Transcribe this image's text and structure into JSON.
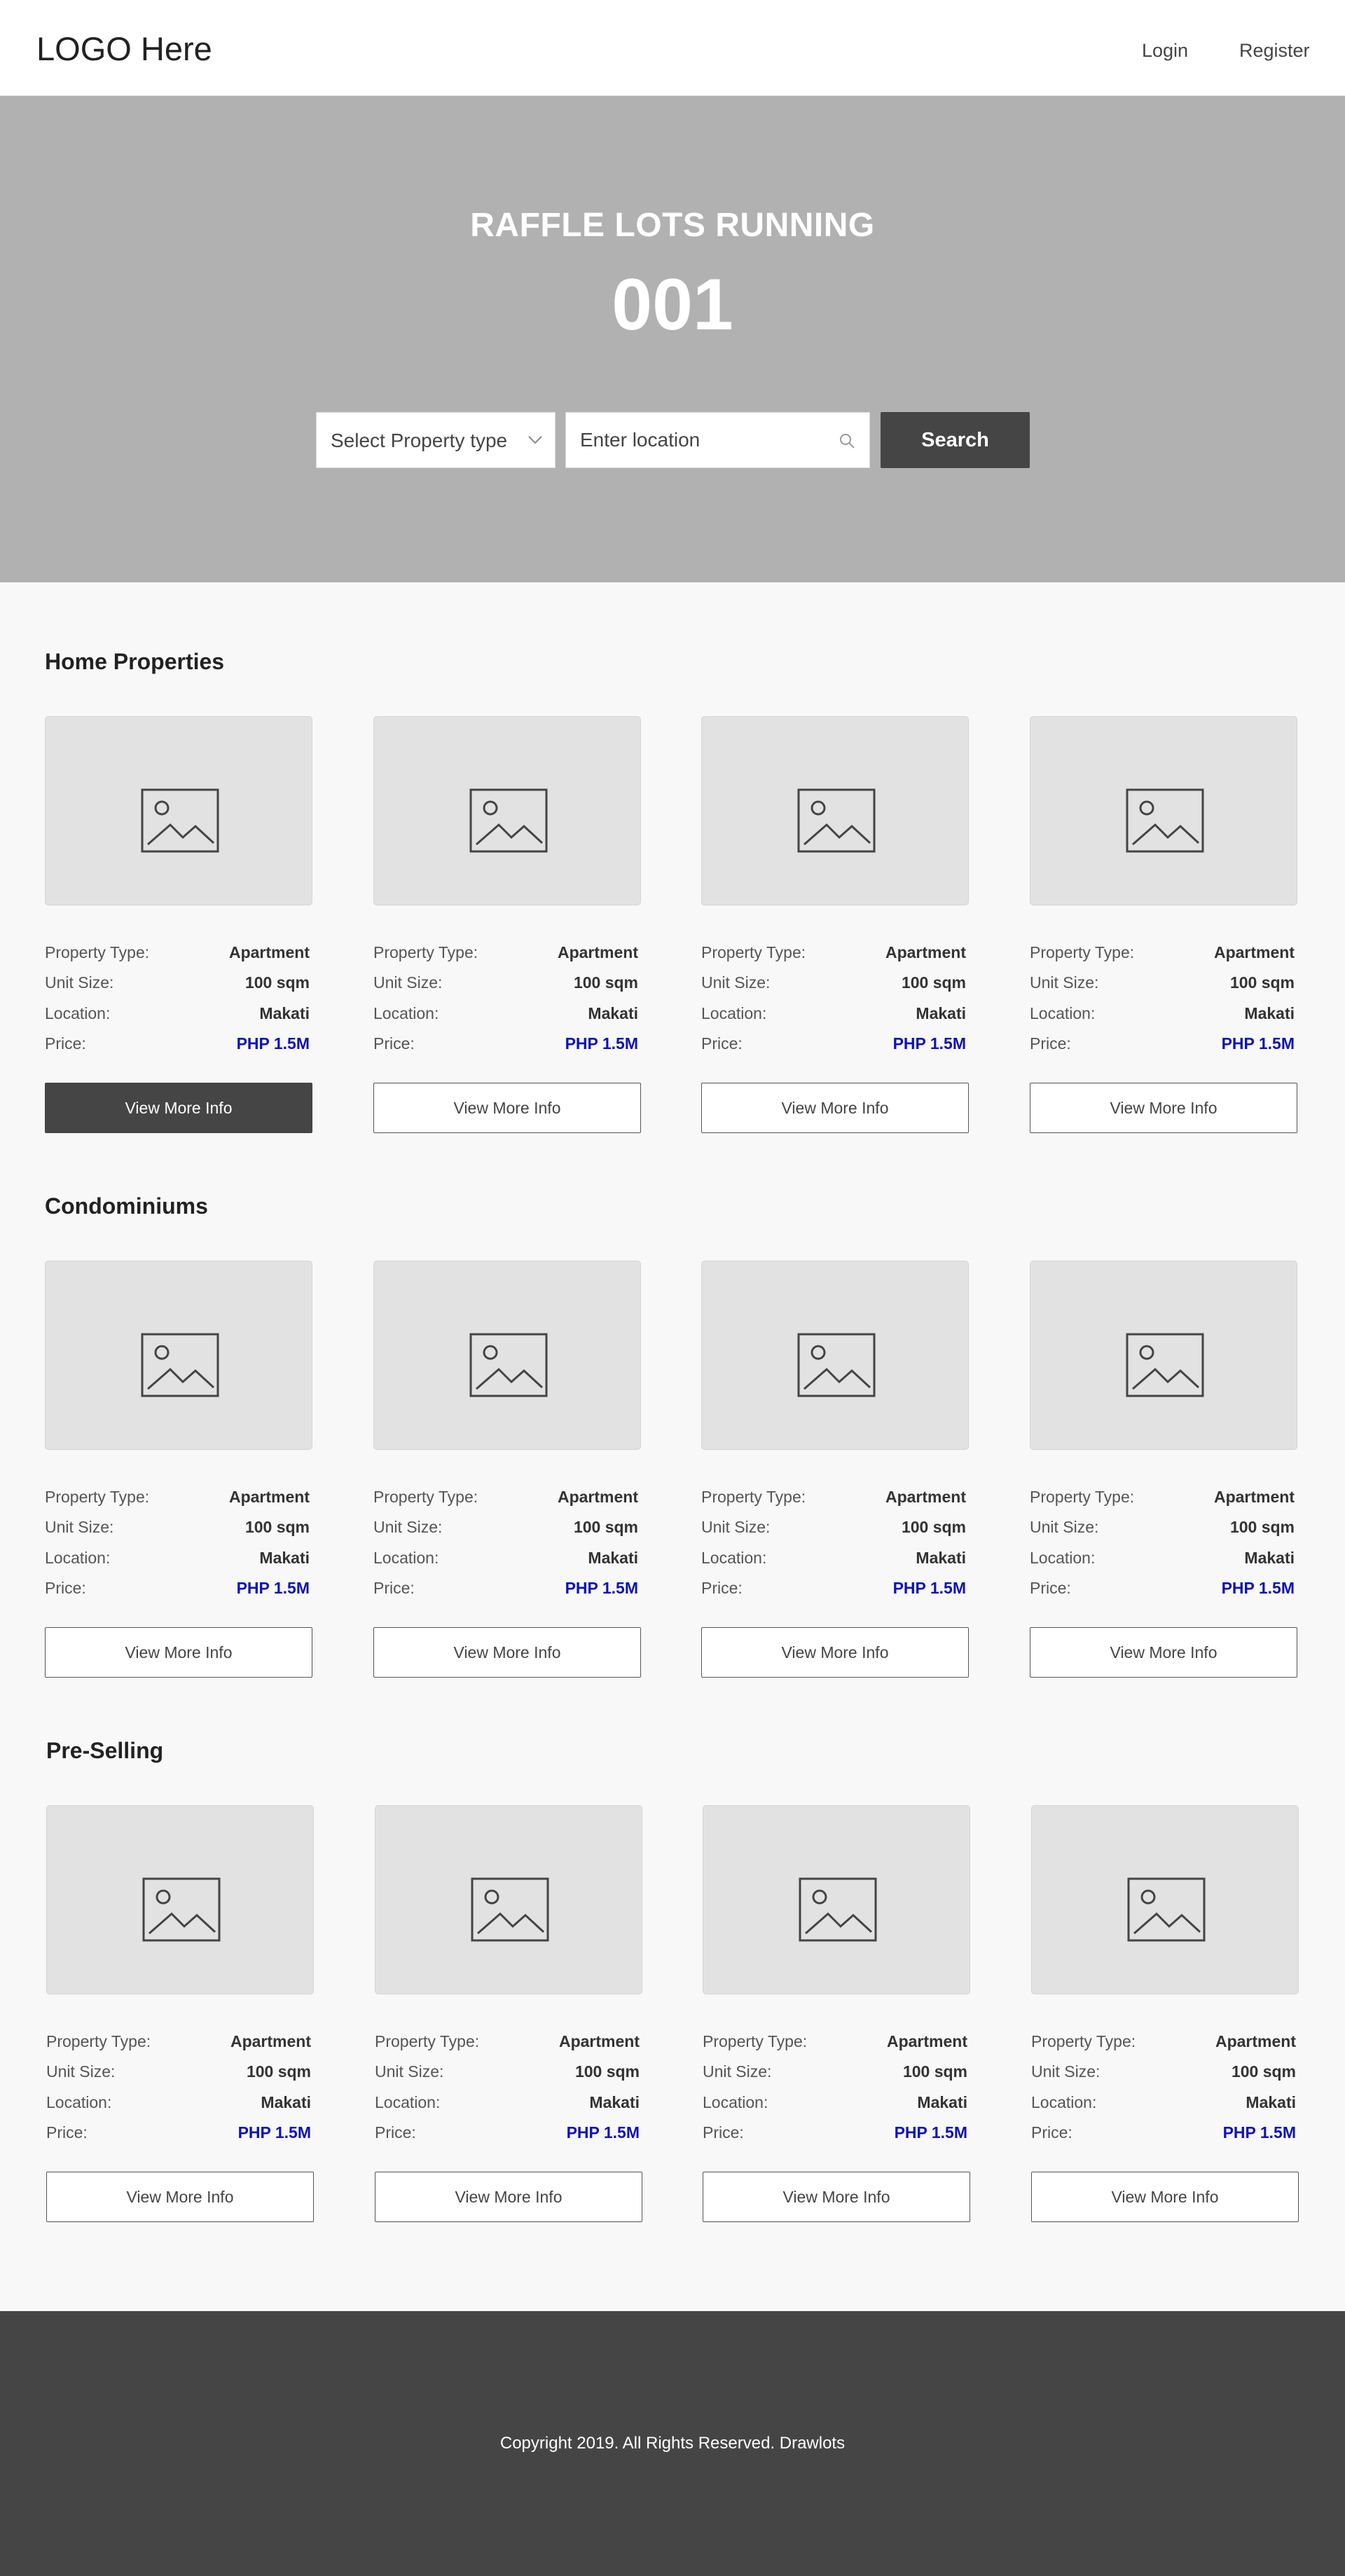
{
  "header": {
    "logo": "LOGO Here",
    "login": "Login",
    "register": "Register"
  },
  "hero": {
    "title": "RAFFLE LOTS RUNNING",
    "count": "001",
    "property_type_select": "Select Property type",
    "location_placeholder": "Enter location",
    "search_button": "Search"
  },
  "card_labels": {
    "property_type": "Property Type:",
    "unit_size": "Unit Size:",
    "location": "Location:",
    "price": "Price:",
    "button": "View More Info"
  },
  "sections": [
    {
      "title": "Home Properties",
      "cards": [
        {
          "property_type": "Apartment",
          "unit_size": "100 sqm",
          "location": "Makati",
          "price": "PHP 1.5M"
        },
        {
          "property_type": "Apartment",
          "unit_size": "100 sqm",
          "location": "Makati",
          "price": "PHP 1.5M"
        },
        {
          "property_type": "Apartment",
          "unit_size": "100 sqm",
          "location": "Makati",
          "price": "PHP 1.5M"
        },
        {
          "property_type": "Apartment",
          "unit_size": "100 sqm",
          "location": "Makati",
          "price": "PHP 1.5M"
        }
      ]
    },
    {
      "title": "Condominiums",
      "cards": [
        {
          "property_type": "Apartment",
          "unit_size": "100 sqm",
          "location": "Makati",
          "price": "PHP 1.5M"
        },
        {
          "property_type": "Apartment",
          "unit_size": "100 sqm",
          "location": "Makati",
          "price": "PHP 1.5M"
        },
        {
          "property_type": "Apartment",
          "unit_size": "100 sqm",
          "location": "Makati",
          "price": "PHP 1.5M"
        },
        {
          "property_type": "Apartment",
          "unit_size": "100 sqm",
          "location": "Makati",
          "price": "PHP 1.5M"
        }
      ]
    },
    {
      "title": "Pre-Selling",
      "cards": [
        {
          "property_type": "Apartment",
          "unit_size": "100 sqm",
          "location": "Makati",
          "price": "PHP 1.5M"
        },
        {
          "property_type": "Apartment",
          "unit_size": "100 sqm",
          "location": "Makati",
          "price": "PHP 1.5M"
        },
        {
          "property_type": "Apartment",
          "unit_size": "100 sqm",
          "location": "Makati",
          "price": "PHP 1.5M"
        },
        {
          "property_type": "Apartment",
          "unit_size": "100 sqm",
          "location": "Makati",
          "price": "PHP 1.5M"
        }
      ]
    }
  ],
  "footer": {
    "copyright": "Copyright 2019. All Rights Reserved. Drawlots"
  },
  "colors": {
    "hero_bg": "#b2b1b2",
    "dark": "#454545",
    "price": "#0d13b4",
    "image_placeholder": "#e2e2e2"
  }
}
